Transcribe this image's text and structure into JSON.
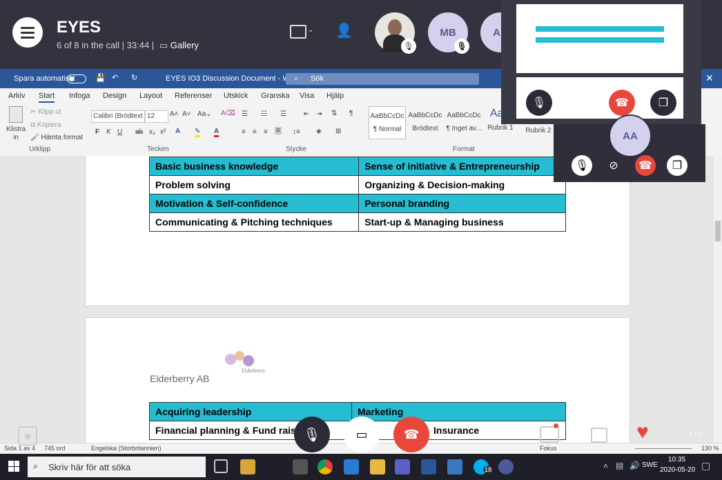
{
  "call": {
    "title": "EYES",
    "subtitle": "6 of 8 in the call | 33:44  |",
    "view_label": "Gallery",
    "participants": [
      {
        "initials": "",
        "has_photo": true
      },
      {
        "initials": "MB"
      },
      {
        "initials": "AA"
      }
    ]
  },
  "word": {
    "autosave_label": "Spara automatiskt",
    "doc_title": "EYES IO3 Discussion Document  -  Word",
    "search_placeholder": "Sök",
    "tabs": [
      "Arkiv",
      "Start",
      "Infoga",
      "Design",
      "Layout",
      "Referenser",
      "Utskick",
      "Granska",
      "Visa",
      "Hjälp"
    ],
    "active_tab": "Start",
    "clipboard": {
      "paste": "Klistra in",
      "cut": "Klipp ut",
      "copy": "Kopiera",
      "format_painter": "Hämta format",
      "group": "Urklipp"
    },
    "font": {
      "name": "Calibri (Brödtext",
      "size": "12",
      "group": "Tecken"
    },
    "paragraph_group": "Stycke",
    "styles_group": "Format",
    "styles": [
      {
        "preview": "AaBbCcDc",
        "name": "¶ Normal"
      },
      {
        "preview": "AaBbCcDc",
        "name": "Brödtext"
      },
      {
        "preview": "AaBbCcDc",
        "name": "¶ Inget av..."
      },
      {
        "preview": "AaB",
        "name": "Rubrik 1"
      },
      {
        "preview": "",
        "name": "Rubrik 2"
      }
    ],
    "table1": [
      [
        "Basic business knowledge",
        "Sense of initiative & Entrepreneurship"
      ],
      [
        "Problem solving",
        "Organizing & Decision-making"
      ],
      [
        "Motivation & Self-confidence",
        "Personal branding"
      ],
      [
        "Communicating & Pitching techniques",
        "Start-up & Managing business"
      ]
    ],
    "company": "Elderberry AB",
    "logo_text": "Elderberry",
    "table2": [
      [
        "Acquiring leadership",
        "Marketing"
      ],
      [
        "Financial planning & Fund raisi",
        "Insurance"
      ]
    ],
    "status": {
      "page": "Sida 1 av 4",
      "words": "745 ord",
      "language": "Engelska (Storbritannien)",
      "focus": "Fokus",
      "zoom": "130 %"
    }
  },
  "taskbar": {
    "search_placeholder": "Skriv här för att söka",
    "lang": "SWE",
    "time": "10:35",
    "date": "2020-05-20",
    "skype_badge": "18"
  },
  "self_preview": {
    "initials": "AA"
  },
  "colors": {
    "accent_cyan": "#26bcd1",
    "end_call": "#e8483b",
    "word_blue": "#2b579a",
    "call_bg": "#33323f"
  }
}
